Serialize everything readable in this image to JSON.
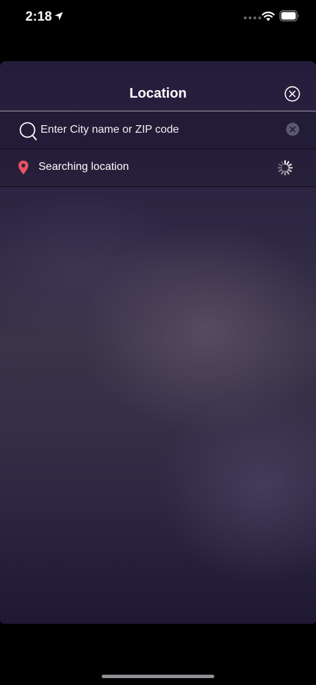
{
  "status_bar": {
    "time": "2:18",
    "icons": [
      "location-arrow-icon",
      "cellular-signal-icon",
      "wifi-icon",
      "battery-icon"
    ]
  },
  "location_panel": {
    "title": "Location",
    "close_icon": "close-circle-icon",
    "search": {
      "placeholder": "Enter City name or ZIP code",
      "value": "",
      "icon": "search-icon",
      "clear_icon": "clear-circle-icon"
    },
    "current_location": {
      "label": "Searching location",
      "icon": "map-pin-icon",
      "status_icon": "loading-spinner-icon"
    }
  },
  "colors": {
    "pin": "#e8525f",
    "panel_top": "#241c3a",
    "panel_mid": "#3a3448",
    "panel_bottom": "#1f1834"
  }
}
